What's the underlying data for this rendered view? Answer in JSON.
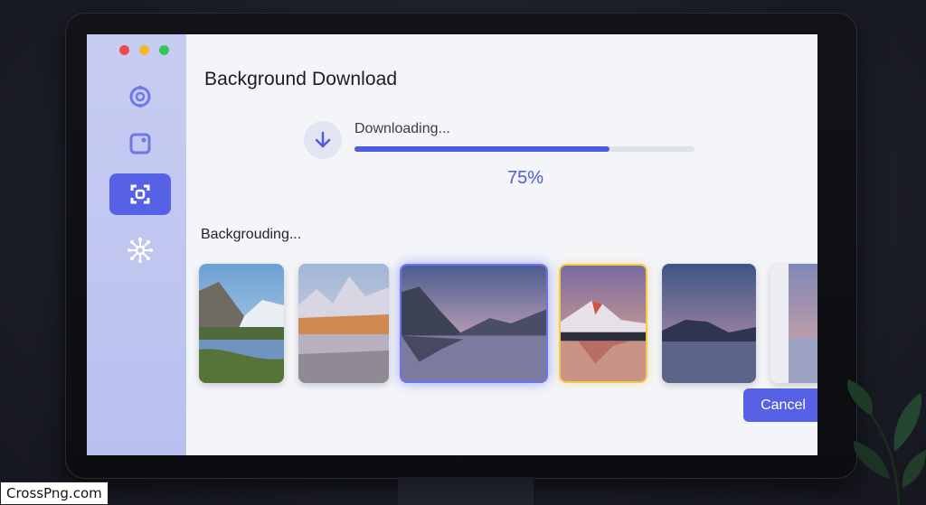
{
  "window": {
    "traffic_lights": {
      "close": "#ef4a4a",
      "minimize": "#f4b92a",
      "maximize": "#33c75a"
    }
  },
  "sidebar": {
    "items": [
      {
        "icon": "circular-arrows-icon",
        "active": false
      },
      {
        "icon": "photo-frame-icon",
        "active": false
      },
      {
        "icon": "screenshot-capture-icon",
        "active": true
      },
      {
        "icon": "network-hub-icon",
        "active": false
      }
    ]
  },
  "main": {
    "title": "Background Download",
    "download": {
      "icon": "download-arrow-icon",
      "status_label": "Downloading...",
      "progress": 0.75,
      "percent_text": "75%"
    },
    "section_label": "Backgrouding...",
    "thumbnails": [
      {
        "name": "mountain-valley-lake",
        "state": "normal"
      },
      {
        "name": "snowy-peaks-autumn",
        "state": "normal"
      },
      {
        "name": "dusk-mountain-lake",
        "state": "selected"
      },
      {
        "name": "sunset-snow-peak",
        "state": "highlighted"
      },
      {
        "name": "twilight-hills-lake",
        "state": "normal"
      },
      {
        "name": "partial-lake-page",
        "state": "normal"
      }
    ],
    "cancel_label": "Cancel"
  },
  "colors": {
    "accent": "#5661e6",
    "progress": "#4f5ae0",
    "sidebar": "#c7cdf2"
  },
  "watermark": "CrossPng.com"
}
